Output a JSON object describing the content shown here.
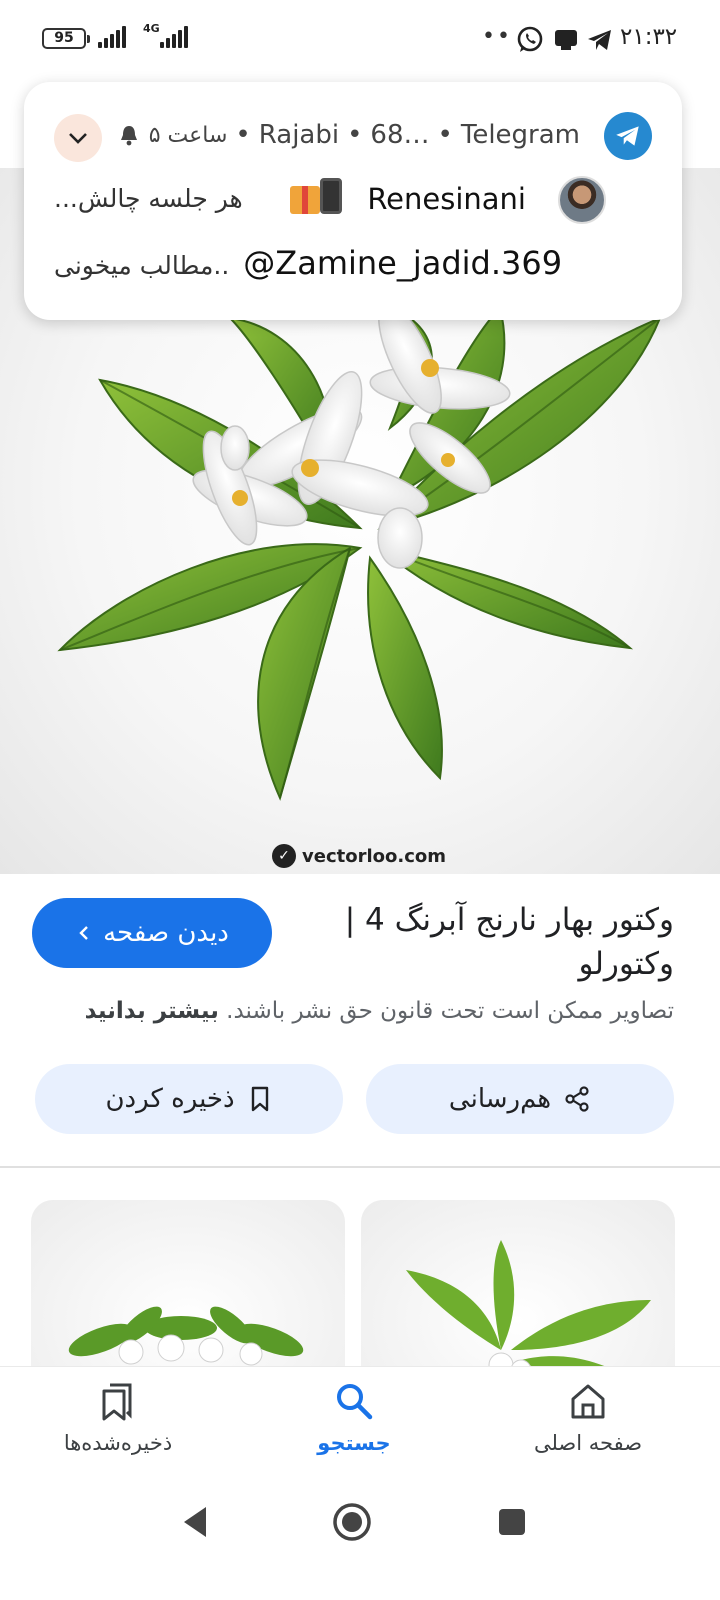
{
  "status_bar": {
    "battery": "95",
    "network": "4G",
    "dots": "••",
    "time": "۲۱:۳۲",
    "icons": [
      "whatsapp-icon",
      "teams-icon",
      "telegram-icon"
    ]
  },
  "notification": {
    "app": "Telegram",
    "chat_truncated": "68…",
    "author": "Rajabi",
    "time": "۵ ساعت",
    "sender": "Renesinani",
    "preview_text": "هر جلسه چالش...",
    "handle": "@Zamine_jadid.369",
    "line2_text": "مطالب میخونی.."
  },
  "image": {
    "watermark": "vectorloo.com"
  },
  "result": {
    "title": "وکتور بهار نارنج آبرنگ 4 | وکتورلو",
    "view_button": "دیدن صفحه",
    "copyright_text": "تصاویر ممکن است تحت قانون حق نشر باشند.",
    "learn_more": "بیشتر بدانید",
    "share_label": "هم‌رسانی",
    "save_label": "ذخیره کردن"
  },
  "bottom_nav": {
    "items": [
      {
        "label": "ذخیره‌شده‌ها",
        "icon": "bookmarks-icon"
      },
      {
        "label": "جستجو",
        "icon": "search-icon",
        "active": true
      },
      {
        "label": "صفحه اصلی",
        "icon": "home-icon"
      }
    ]
  },
  "colors": {
    "accent": "#1a73e8",
    "pill_bg": "#e8f0fe",
    "telegram": "#2689d0"
  }
}
